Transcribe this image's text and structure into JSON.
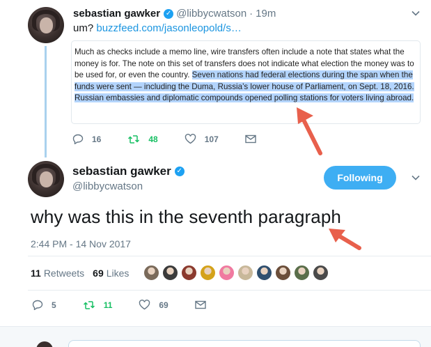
{
  "quoted_tweet": {
    "name": "sebastian gawker",
    "handle": "@libbycwatson",
    "separator": "·",
    "time": "19m",
    "text_prefix": "um? ",
    "link": "buzzfeed.com/jasonleopold/s…",
    "card_text_normal": "Much as checks include a memo line, wire transfers often include a note that states what the money is for. The note on this set of transfers does not indicate what election the money was to be used for, or even the country. ",
    "card_text_highlighted": "Seven nations had federal elections during the span when the funds were sent — including the Duma, Russia’s lower house of Parliament, on Sept. 18, 2016. Russian embassies and diplomatic compounds opened polling stations for voters living abroad.",
    "replies": "16",
    "retweets": "48",
    "likes": "107"
  },
  "main_tweet": {
    "name": "sebastian gawker",
    "handle": "@libbycwatson",
    "follow_label": "Following",
    "text": "why was this in the seventh paragraph",
    "timestamp": "2:44 PM - 14 Nov 2017",
    "retweet_count": "11",
    "retweet_label": "Retweets",
    "like_count": "69",
    "like_label": "Likes",
    "replies": "5",
    "retweets": "11",
    "likes": "69"
  },
  "likers": [
    "#7a6a5a",
    "#3b3b3b",
    "#8b3a2e",
    "#d4a21a",
    "#f07aa0",
    "#c8b89a",
    "#2f4f6f",
    "#6b4e3a",
    "#5a6e4a",
    "#4a4a4a"
  ],
  "colors": {
    "accent": "#1da1f2",
    "link": "#1b95e0",
    "retweet_green": "#17bf63",
    "muted": "#657786",
    "highlight": "#b3d4fc",
    "arrow": "#e8604c"
  },
  "icons": {
    "verified": "verified-badge-icon",
    "chevron": "chevron-down-icon",
    "reply": "reply-icon",
    "retweet": "retweet-icon",
    "like": "heart-icon",
    "dm": "envelope-icon"
  }
}
